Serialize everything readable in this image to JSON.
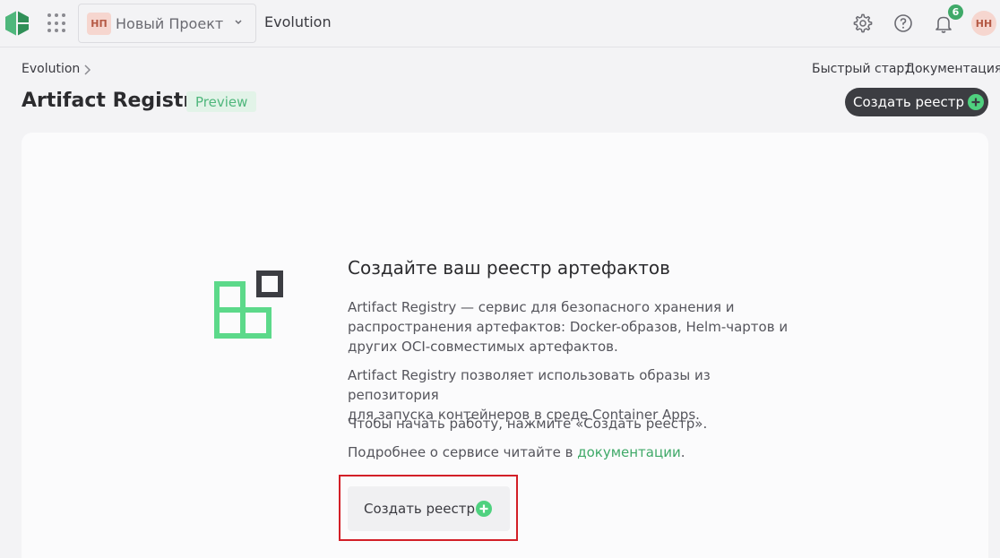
{
  "topbar": {
    "project_initials": "НП",
    "project_name": "Новый Проект",
    "brand": "Evolution",
    "notifications_count": "6",
    "user_initials": "НН"
  },
  "header": {
    "breadcrumb": "Evolution",
    "quick_start": "Быстрый старт",
    "docs": "Документация",
    "title": "Artifact Registry",
    "badge": "Preview",
    "create_button": "Создать реестр"
  },
  "empty_state": {
    "title": "Создайте ваш реестр артефактов",
    "para1": [
      "Artifact Registry — сервис для безопасного хранения и",
      "распространения артефактов: Docker-образов, Helm-чартов и",
      "других OCI-совместимых артефактов."
    ],
    "para2": [
      "Artifact Registry позволяет использовать образы из репозитория",
      "для запуска контейнеров в среде Container Apps."
    ],
    "para3": "Чтобы начать работу, нажмите «Создать реестр».",
    "para4_prefix": "Подробнее о сервисе читайте в ",
    "para4_link": "документации",
    "para4_suffix": ".",
    "create_button": "Создать реестр"
  },
  "colors": {
    "accent": "#3fa968",
    "dark_button": "#3c3d42",
    "highlight": "#d31f27"
  }
}
